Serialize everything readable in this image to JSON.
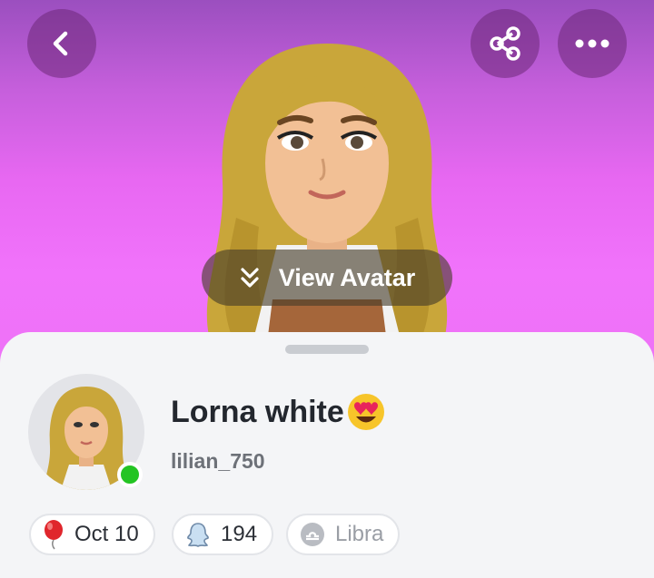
{
  "header": {
    "back_icon": "chevron-left-icon",
    "share_icon": "share-icon",
    "more_icon": "more-horizontal-icon",
    "background_gradient": [
      "#9b4fbf",
      "#f173fb"
    ]
  },
  "view_avatar": {
    "label": "View Avatar",
    "icon": "double-chevron-down-icon"
  },
  "profile": {
    "display_name": "Lorna white",
    "name_emoji": "heart-eyes-emoji",
    "username": "lilian_750",
    "online_status_color": "#23c423"
  },
  "chips": [
    {
      "icon": "balloon-icon",
      "text": "Oct 10"
    },
    {
      "icon": "snapscore-ghost-icon",
      "text": "194"
    },
    {
      "icon": "libra-zodiac-icon",
      "text": "Libra"
    }
  ]
}
